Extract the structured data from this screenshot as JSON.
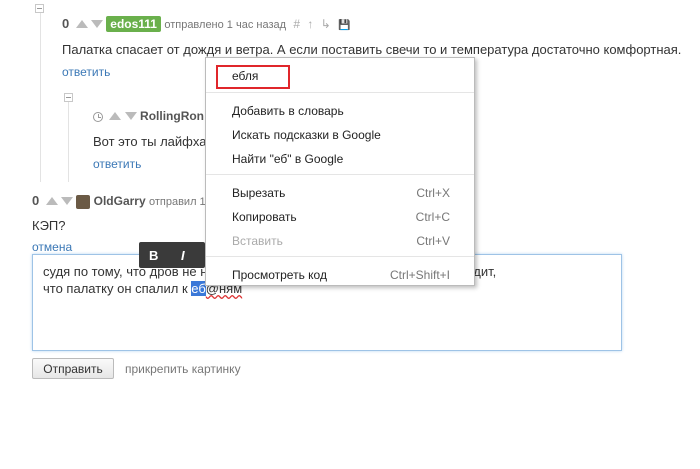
{
  "comment1": {
    "rating": "0",
    "user": "edos111",
    "meta": "отправлено 1 час назад",
    "tools": [
      "#",
      "↑",
      "↳",
      "💾"
    ],
    "text": "Палатка спасает от дождя и ветра. А если поставить свечи то и температура достаточно комфортная.",
    "reply": "ответить"
  },
  "comment2": {
    "user": "RollingRon",
    "text": "Вот это ты лайфхак",
    "reply": "ответить"
  },
  "comment3": {
    "rating": "0",
    "user": "OldGarry",
    "meta": "отправил 1",
    "text": "КЭП?",
    "cancel": "отмена"
  },
  "editor": {
    "line1_a": "судя по тому, что дров не н",
    "line1_b": "тки, на ум приходит,",
    "line2_a": "что палатку он спалил к ",
    "line2_selected": "еб",
    "line2_b": "@ням"
  },
  "format_bar": {
    "bold": "B",
    "italic": "I"
  },
  "submit": {
    "label": "Отправить",
    "attach": "прикрепить картинку"
  },
  "context_menu": {
    "suggestion": "ебля",
    "add_dictionary": "Добавить в словарь",
    "search_google_hints": "Искать подсказки в Google",
    "find_google": "Найти \"еб\" в Google",
    "cut": "Вырезать",
    "cut_shortcut": "Ctrl+X",
    "copy": "Копировать",
    "copy_shortcut": "Ctrl+C",
    "paste": "Вставить",
    "paste_shortcut": "Ctrl+V",
    "inspect": "Просмотреть код",
    "inspect_shortcut": "Ctrl+Shift+I"
  },
  "colors": {
    "accent_link": "#3b78b6",
    "user_badge": "#6ab04c",
    "spell_highlight": "#e0262b"
  }
}
